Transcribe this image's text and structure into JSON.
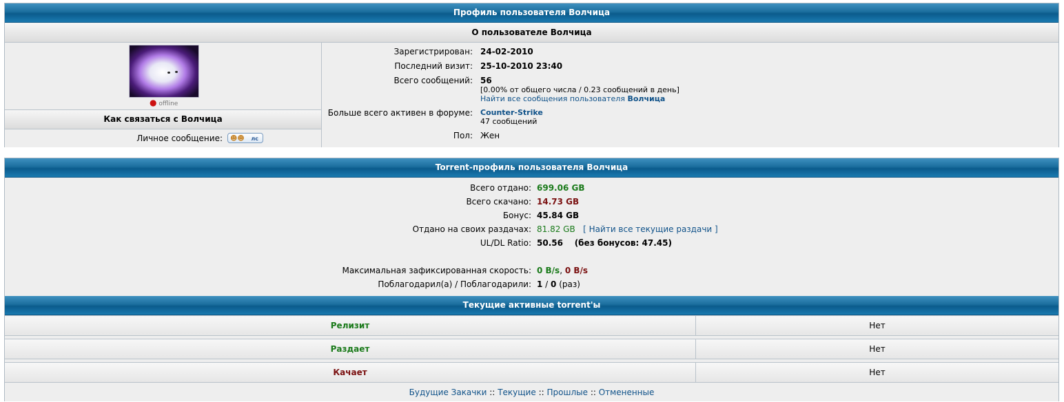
{
  "profile": {
    "title": "Профиль пользователя Волчица",
    "about_heading": "О пользователе Волчица",
    "status": "offline",
    "contact_heading": "Как связаться с Волчица",
    "pm_label": "Личное сообщение:",
    "pm_button": "лс",
    "registered_label": "Зарегистрирован:",
    "registered_value": "24-02-2010",
    "last_visit_label": "Последний визит:",
    "last_visit_value": "25-10-2010 23:40",
    "posts_label": "Всего сообщений:",
    "posts_value": "56",
    "posts_stats": "[0.00% от общего числа / 0.23 сообщений в день]",
    "find_posts_text": "Найти все сообщения пользователя",
    "find_posts_user": "Волчица",
    "most_active_label": "Больше всего активен в форуме:",
    "most_active_forum": "Counter-Strike",
    "most_active_count": "47 сообщений",
    "gender_label": "Пол:",
    "gender_value": "Жен"
  },
  "torrent": {
    "title": "Torrent-профиль пользователя Волчица",
    "uploaded_label": "Всего отдано:",
    "uploaded_value": "699.06 GB",
    "downloaded_label": "Всего скачано:",
    "downloaded_value": "14.73 GB",
    "bonus_label": "Бонус:",
    "bonus_value": "45.84 GB",
    "own_seed_label": "Отдано на своих раздачах:",
    "own_seed_value": "81.82 GB",
    "find_seeds_link": "[ Найти все текущие раздачи ]",
    "ratio_label": "UL/DL Ratio:",
    "ratio_value": "50.56",
    "ratio_extra": "(без бонусов: 47.45)",
    "max_speed_label": "Максимальная зафиксированная скорость:",
    "max_speed_up": "0 B/s",
    "max_speed_sep": ",",
    "max_speed_down": "0 B/s",
    "thanks_label": "Поблагодарил(а) / Поблагодарили:",
    "thanks_given": "1",
    "thanks_sep": " / ",
    "thanks_received": "0",
    "thanks_unit": "(раз)"
  },
  "active": {
    "title": "Текущие активные torrent'ы",
    "rows": [
      {
        "label": "Релизит",
        "value": "Нет"
      },
      {
        "label": "Раздает",
        "value": "Нет"
      },
      {
        "label": "Качает",
        "value": "Нет"
      }
    ],
    "links": [
      "Будущие Закачки",
      "Текущие",
      "Прошлые",
      "Отмененные"
    ],
    "separator": "::"
  },
  "colors": {
    "header_blue": "#1b6e9e",
    "link": "#105289",
    "green": "#1a7a1a",
    "red": "#7a1010"
  }
}
